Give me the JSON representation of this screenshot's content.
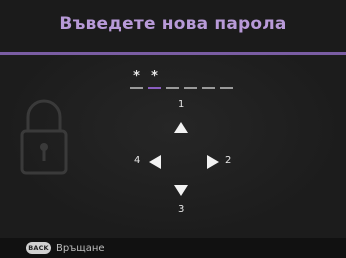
{
  "header": {
    "title": "Въведете нова парола"
  },
  "password": {
    "entered": [
      "*",
      "*",
      "",
      "",
      "",
      ""
    ],
    "active_slot": 1
  },
  "keypad": {
    "up_number": "1",
    "right_number": "2",
    "down_number": "3",
    "left_number": "4"
  },
  "footer": {
    "back_button_label": "BACK",
    "back_text": "Връщане"
  },
  "icons": {
    "lock": "lock-icon",
    "up": "arrow-up-icon",
    "down": "arrow-down-icon",
    "left": "arrow-left-icon",
    "right": "arrow-right-icon"
  },
  "colors": {
    "title": "#b89ad8",
    "accent_line": "#7a5da3",
    "active_underline": "#8a5ec0"
  }
}
